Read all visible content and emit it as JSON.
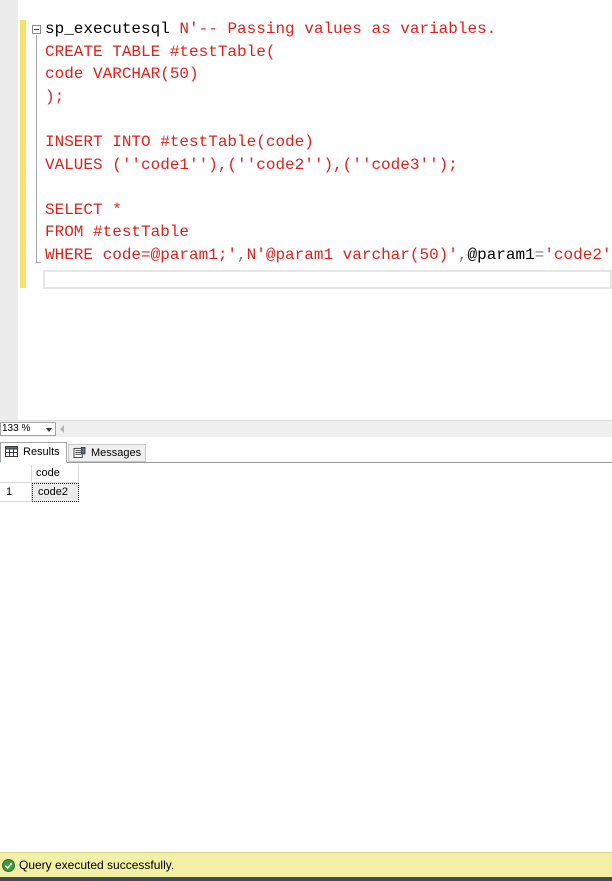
{
  "editor": {
    "lines": [
      {
        "segments": [
          {
            "t": "sp_executesql",
            "c": "black"
          },
          {
            "t": " N'-- Passing values as variables.",
            "c": "red"
          }
        ]
      },
      {
        "segments": [
          {
            "t": "CREATE TABLE #testTable(",
            "c": "red"
          }
        ]
      },
      {
        "segments": [
          {
            "t": "code VARCHAR(50)",
            "c": "red"
          }
        ]
      },
      {
        "segments": [
          {
            "t": ");",
            "c": "red"
          }
        ]
      },
      {
        "segments": [
          {
            "t": "",
            "c": "red"
          }
        ]
      },
      {
        "segments": [
          {
            "t": "INSERT INTO #testTable(code)",
            "c": "red"
          }
        ]
      },
      {
        "segments": [
          {
            "t": "VALUES (''code1''),(''code2''),(''code3'');",
            "c": "red"
          }
        ]
      },
      {
        "segments": [
          {
            "t": "",
            "c": "red"
          }
        ]
      },
      {
        "segments": [
          {
            "t": "SELECT *",
            "c": "red"
          }
        ]
      },
      {
        "segments": [
          {
            "t": "FROM #testTable",
            "c": "red"
          }
        ]
      },
      {
        "segments": [
          {
            "t": "WHERE code=@param1;'",
            "c": "red"
          },
          {
            "t": ",",
            "c": "gray"
          },
          {
            "t": "N'@param1 varchar(50)'",
            "c": "red"
          },
          {
            "t": ",",
            "c": "gray"
          },
          {
            "t": "@param1",
            "c": "black"
          },
          {
            "t": "=",
            "c": "gray"
          },
          {
            "t": "'code2'",
            "c": "red"
          }
        ]
      }
    ]
  },
  "zoom": {
    "value": "133 %"
  },
  "tabs": {
    "results": "Results",
    "messages": "Messages"
  },
  "grid": {
    "columns": [
      "code"
    ],
    "rows": [
      {
        "num": "1",
        "values": [
          "code2"
        ]
      }
    ]
  },
  "status": {
    "text": "Query executed successfully."
  },
  "colors": {
    "status_bg": "#f3f0a6",
    "code_red": "#e0201b",
    "change_bar": "#f2e468"
  }
}
